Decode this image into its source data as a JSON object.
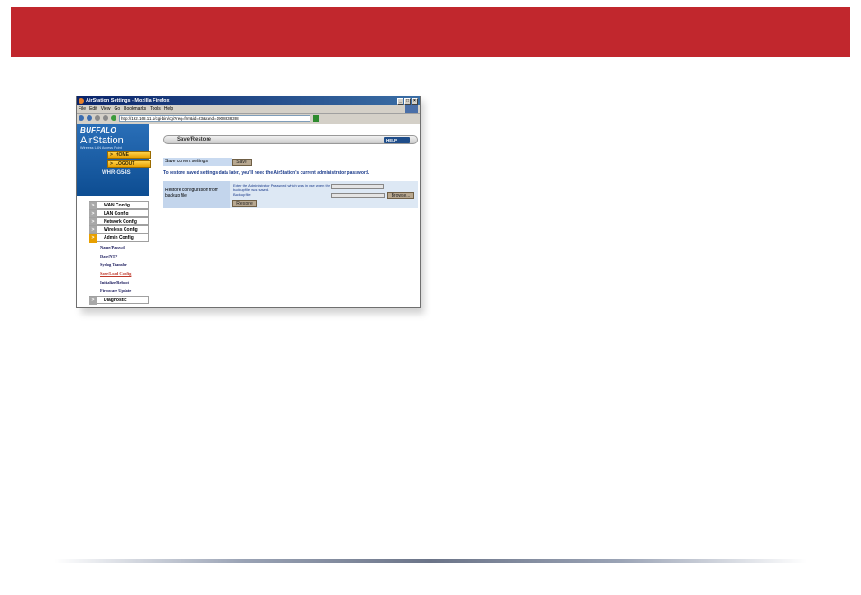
{
  "browser": {
    "title": "AirStation Settings - Mozilla Firefox",
    "menu": [
      "File",
      "Edit",
      "View",
      "Go",
      "Bookmarks",
      "Tools",
      "Help"
    ],
    "url": "http://192.168.11.1/cgi-bin/cgi?req=frm&id=23&rand=1908838398",
    "controls": [
      "_",
      "□",
      "×"
    ]
  },
  "sidebar": {
    "brand": "BUFFALO",
    "product": "AirStation",
    "product_sub": "Wireless LAN Access Point",
    "home_label": "HOME",
    "logout_label": "LOGOUT",
    "model": "WHR-G54S",
    "menu": [
      {
        "label": "WAN Config"
      },
      {
        "label": "LAN Config"
      },
      {
        "label": "Network Config"
      },
      {
        "label": "Wireless Config"
      },
      {
        "label": "Admin Config"
      }
    ],
    "submenu": [
      {
        "label": "Name/Passwd"
      },
      {
        "label": "Date/NTP"
      },
      {
        "label": "Syslog Transfer"
      },
      {
        "label": "Save/Load Config"
      },
      {
        "label": "Initialize/Reboot"
      },
      {
        "label": "Firmware Update"
      }
    ],
    "diagnostic_label": "Diagnostic"
  },
  "main": {
    "page_title": "Save/Restore",
    "help_label": "HELP",
    "save_row_label": "Save current settings",
    "save_button": "Save",
    "notice": "To restore saved settings data later, you'll need the AirStation's current administrator password.",
    "restore_label": "Restore configuration from backup file",
    "pw_hint": "Enter the Administrator Password which was in use when the backup file was saved.",
    "backup_file_label": "Backup file",
    "browse_button": "Browse...",
    "restore_button": "Restore"
  }
}
